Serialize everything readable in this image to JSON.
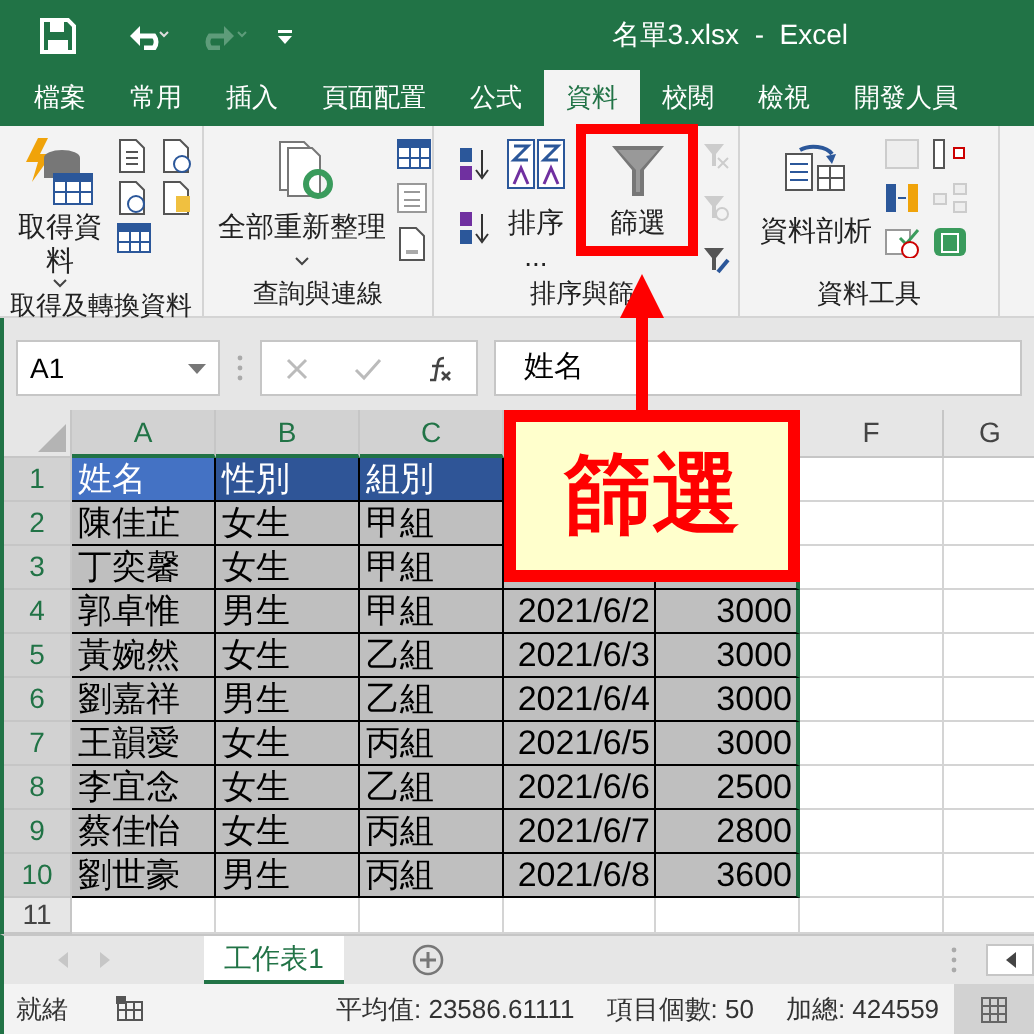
{
  "window": {
    "title": "名單3.xlsx  -  Excel"
  },
  "tabs": [
    {
      "label": "檔案",
      "selected": false
    },
    {
      "label": "常用",
      "selected": false
    },
    {
      "label": "插入",
      "selected": false
    },
    {
      "label": "頁面配置",
      "selected": false
    },
    {
      "label": "公式",
      "selected": false
    },
    {
      "label": "資料",
      "selected": true
    },
    {
      "label": "校閱",
      "selected": false
    },
    {
      "label": "檢視",
      "selected": false
    },
    {
      "label": "開發人員",
      "selected": false
    }
  ],
  "ribbon": {
    "groups": [
      {
        "label": "取得及轉換資料",
        "buttons": [
          "取得資料"
        ]
      },
      {
        "label": "查詢與連線",
        "buttons": [
          "全部重新整理"
        ]
      },
      {
        "label": "排序與篩",
        "buttons": [
          "排序 ...",
          "篩選"
        ]
      },
      {
        "label": "資料工具",
        "buttons": [
          "資料剖析"
        ]
      }
    ]
  },
  "formula_bar": {
    "name_box": "A1",
    "formula": "姓名"
  },
  "columns": [
    {
      "label": "A",
      "selected": true
    },
    {
      "label": "B",
      "selected": true
    },
    {
      "label": "C",
      "selected": true
    },
    {
      "label": "F",
      "selected": false
    },
    {
      "label": "G",
      "selected": false
    }
  ],
  "rows": [
    {
      "label": "1",
      "kind": "header",
      "selected": true,
      "cells": [
        "姓名",
        "性別",
        "組別"
      ]
    },
    {
      "label": "2",
      "kind": "data",
      "selected": true,
      "cells": [
        "陳佳芷",
        "女生",
        "甲組"
      ]
    },
    {
      "label": "3",
      "kind": "data",
      "selected": true,
      "cells": [
        "丁奕馨",
        "女生",
        "甲組"
      ]
    },
    {
      "label": "4",
      "kind": "data",
      "selected": true,
      "cells": [
        "郭卓惟",
        "男生",
        "甲組",
        "2021/6/2",
        "3000"
      ]
    },
    {
      "label": "5",
      "kind": "data",
      "selected": true,
      "cells": [
        "黃婉然",
        "女生",
        "乙組",
        "2021/6/3",
        "3000"
      ]
    },
    {
      "label": "6",
      "kind": "data",
      "selected": true,
      "cells": [
        "劉嘉祥",
        "男生",
        "乙組",
        "2021/6/4",
        "3000"
      ]
    },
    {
      "label": "7",
      "kind": "data",
      "selected": true,
      "cells": [
        "王韻愛",
        "女生",
        "丙組",
        "2021/6/5",
        "3000"
      ]
    },
    {
      "label": "8",
      "kind": "data",
      "selected": true,
      "cells": [
        "李宜念",
        "女生",
        "乙組",
        "2021/6/6",
        "2500"
      ]
    },
    {
      "label": "9",
      "kind": "data",
      "selected": true,
      "cells": [
        "蔡佳怡",
        "女生",
        "丙組",
        "2021/6/7",
        "2800"
      ]
    },
    {
      "label": "10",
      "kind": "data",
      "selected": true,
      "cells": [
        "劉世豪",
        "男生",
        "丙組",
        "2021/6/8",
        "3600"
      ]
    },
    {
      "label": "11",
      "selected": false,
      "cells": []
    }
  ],
  "sheet_tabs": [
    {
      "label": "工作表1",
      "selected": true
    }
  ],
  "status_bar": {
    "state": "就緒",
    "average": "平均值: 23586.61111",
    "count": "項目個數: 50",
    "sum": "加總: 424559"
  },
  "callout": {
    "text": "篩選"
  }
}
